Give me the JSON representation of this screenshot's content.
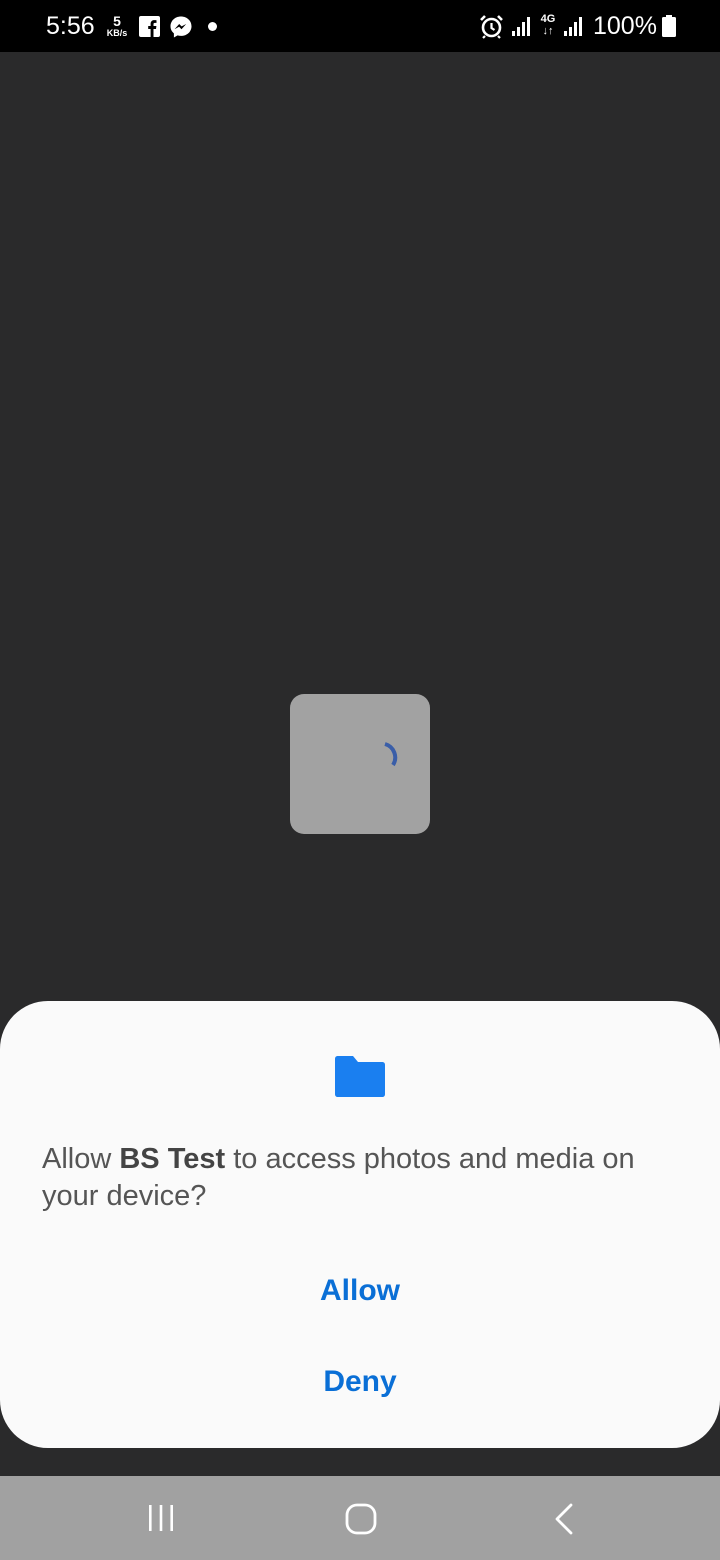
{
  "status_bar": {
    "time": "5:56",
    "speed_value": "5",
    "speed_unit": "KB/s",
    "network_type": "4G",
    "network_arrows": "↓↑",
    "battery_percent": "100%",
    "icons": [
      "facebook-icon",
      "messenger-icon",
      "notification-dot",
      "alarm-icon",
      "signal-icon",
      "signal-icon",
      "battery-icon"
    ]
  },
  "loader": {
    "spinner_color": "#3a5ea8",
    "box_color": "#a2a2a2"
  },
  "dialog": {
    "icon": "folder-icon",
    "icon_color": "#1a7ff0",
    "message_prefix": "Allow ",
    "app_name": "BS Test",
    "message_suffix": " to access photos and media on your device?",
    "allow_label": "Allow",
    "deny_label": "Deny",
    "button_color": "#0a6fd6"
  },
  "nav_bar": {
    "buttons": [
      "recents-icon",
      "home-icon",
      "back-icon"
    ]
  }
}
